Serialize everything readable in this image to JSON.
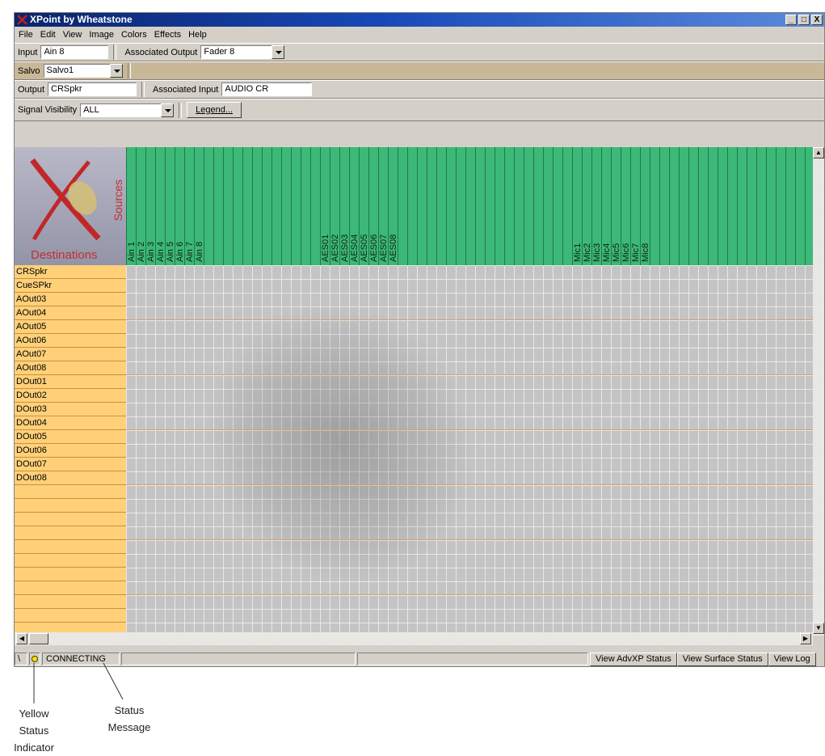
{
  "window": {
    "title": "XPoint by Wheatstone",
    "buttons": [
      "_",
      "□",
      "X"
    ]
  },
  "menu": [
    "File",
    "Edit",
    "View",
    "Image",
    "Colors",
    "Effects",
    "Help"
  ],
  "input_row": {
    "input_label": "Input",
    "input_value": "Ain 8",
    "assoc_output_label": "Associated Output",
    "assoc_output_value": "Fader 8"
  },
  "salvo_row": {
    "label": "Salvo",
    "value": "Salvo1"
  },
  "output_row": {
    "output_label": "Output",
    "output_value": "CRSpkr",
    "assoc_input_label": "Associated Input",
    "assoc_input_value": "AUDIO CR"
  },
  "visibility_row": {
    "label": "Signal Visibility",
    "value": "ALL",
    "legend_button": "Legend..."
  },
  "matrix": {
    "corner_destinations": "Destinations",
    "corner_sources": "Sources",
    "sources": [
      "Ain 1",
      "Ain 2",
      "Ain 3",
      "Ain 4",
      "Ain 5",
      "Ain 6",
      "Ain 7",
      "Ain 8",
      "",
      "",
      "",
      "",
      "",
      "",
      "",
      "",
      "",
      "",
      "",
      "",
      "AES01",
      "AES02",
      "AES03",
      "AES04",
      "AES05",
      "AES06",
      "AES07",
      "AES08",
      "",
      "",
      "",
      "",
      "",
      "",
      "",
      "",
      "",
      "",
      "",
      "",
      "",
      "",
      "",
      "",
      "",
      "",
      "Mic1",
      "Mic2",
      "Mic3",
      "Mic4",
      "Mic5",
      "Mic6",
      "Mic7",
      "Mic8"
    ],
    "destinations": [
      "CRSpkr",
      "CueSPkr",
      "AOut03",
      "AOut04",
      "AOut05",
      "AOut06",
      "AOut07",
      "AOut08",
      "DOut01",
      "DOut02",
      "DOut03",
      "DOut04",
      "DOut05",
      "DOut06",
      "DOut07",
      "DOut08"
    ]
  },
  "status": {
    "slash": "\\",
    "message": "CONNECTING",
    "buttons": [
      "View AdvXP Status",
      "View Surface Status",
      "View Log"
    ]
  },
  "annotations": {
    "indicator": "Yellow\nStatus\nIndicator",
    "message": "Status\nMessage"
  },
  "colors": {
    "source_header": "#3cb878",
    "destination_header": "#ffd078",
    "status_indicator": "#ffe000"
  }
}
